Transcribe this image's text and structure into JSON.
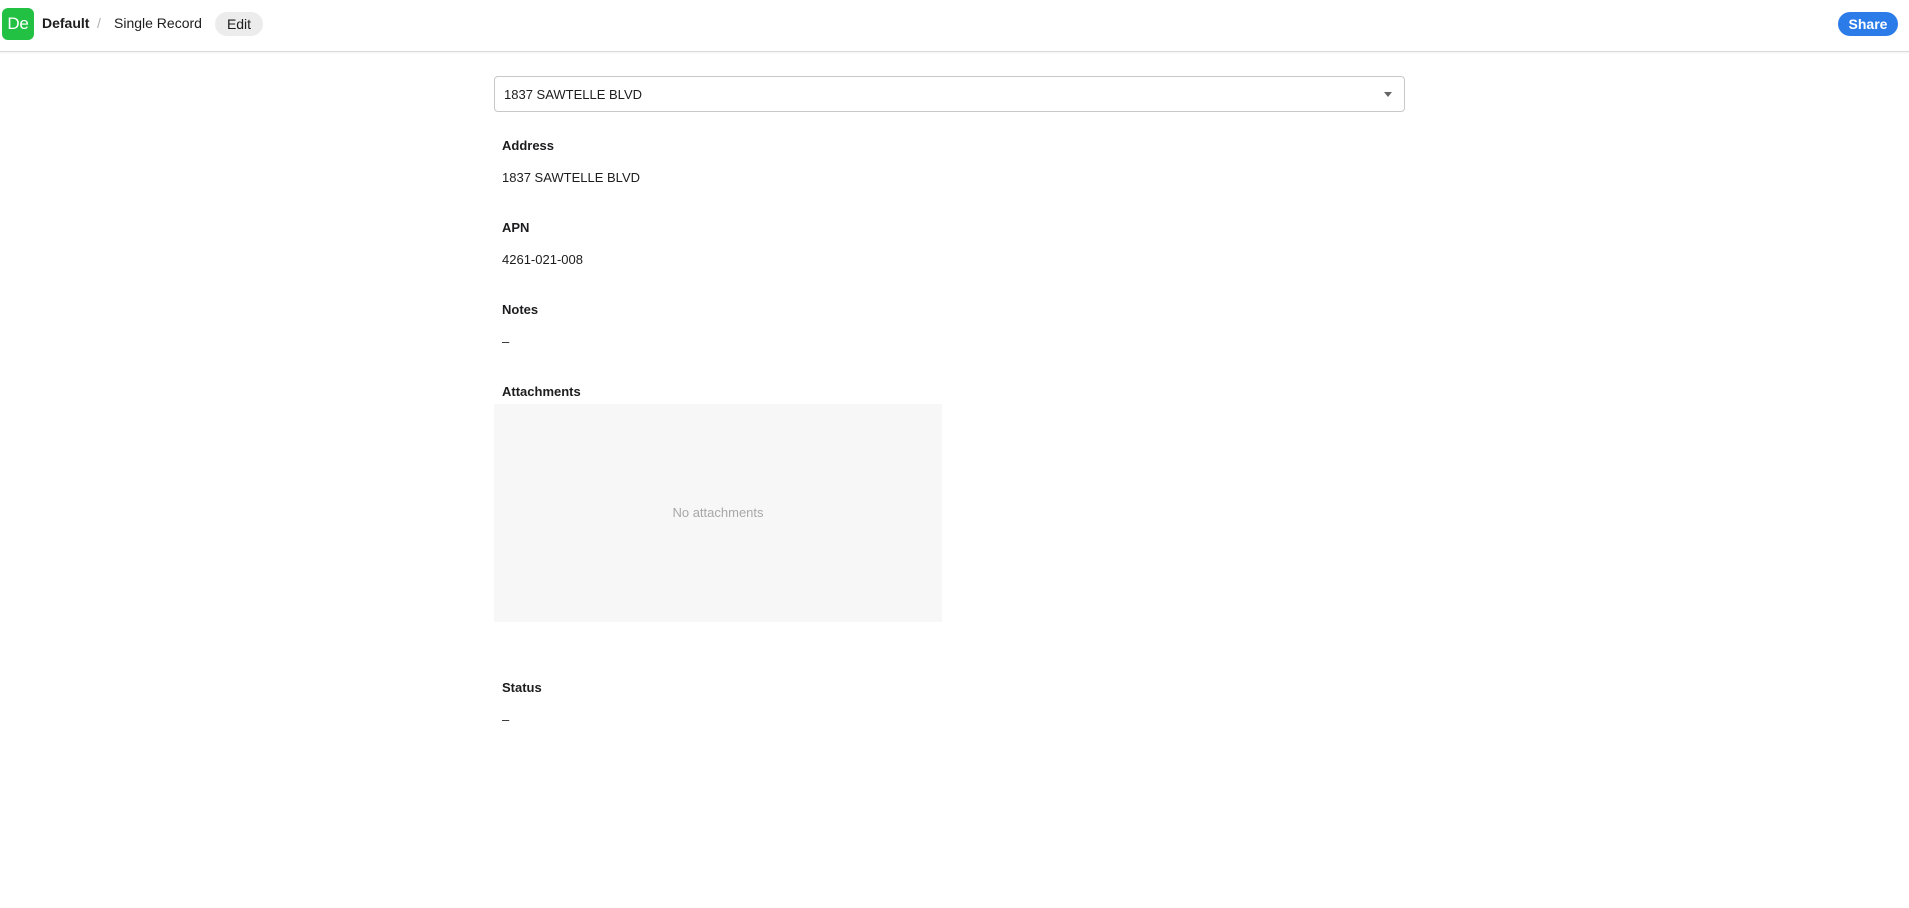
{
  "header": {
    "logo_text": "De",
    "logo_color": "#22c144",
    "breadcrumb": {
      "workspace": "Default",
      "separator": "/",
      "page": "Single Record"
    },
    "edit_label": "Edit",
    "share_label": "Share",
    "share_color": "#2b7ce9"
  },
  "record_selector": {
    "selected": "1837 SAWTELLE BLVD",
    "icon": "chevron-down-icon"
  },
  "fields": {
    "address": {
      "label": "Address",
      "value": "1837 SAWTELLE BLVD"
    },
    "apn": {
      "label": "APN",
      "value": "4261-021-008"
    },
    "notes": {
      "label": "Notes",
      "value": "–"
    },
    "attachments": {
      "label": "Attachments",
      "empty_text": "No attachments"
    },
    "status": {
      "label": "Status",
      "value": "–"
    }
  }
}
